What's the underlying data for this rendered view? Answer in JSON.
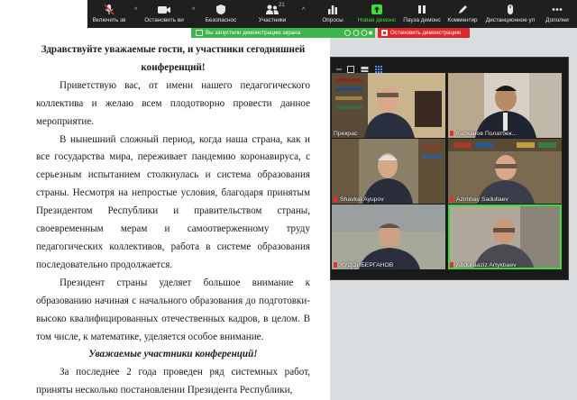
{
  "document": {
    "title": "Здравствуйте уважаемые гости, и участники сегодняшней конференций!",
    "paragraphs": [
      "Приветствую вас, от имени нашего педагогического коллектива и желаю всем плодотворно провести данное мероприятие.",
      "В нынешний сложный период, когда наша страна, как и все государства мира, переживает пандемию коронавируса, с серьезным испытанием столкнулась и система образования страны. Несмотря на непростые условия, благодаря принятым Президентом Республики и правительством страны, своевременным мерам и самоотверженному труду педагогических коллективов, работа в системе образования последовательно продолжается.",
      "Президент страны уделяет большое внимание к образованию начиная с начального образования до подготовки-высоко квалифицированных отечественных кадров, в целом. В том числе, к математике, уделяется особое внимание."
    ],
    "address": "Уважаемые участники конференций!",
    "last_paragraph": "За последнее 2 года проведен ряд системных работ, приняты несколько постановлении Президента Республики,"
  },
  "toolbar": {
    "items": [
      {
        "label": "Включить зв",
        "icon": "mic-muted-icon"
      },
      {
        "label": "Остановить ви",
        "icon": "video-icon"
      },
      {
        "label": "Безопаснос",
        "icon": "shield-icon"
      },
      {
        "label": "Участники",
        "icon": "participants-icon",
        "count": "21"
      },
      {
        "label": "Опросы",
        "icon": "polls-icon"
      },
      {
        "label": "Новая демонс",
        "icon": "share-screen-icon"
      },
      {
        "label": "Пауза демонс",
        "icon": "pause-icon"
      },
      {
        "label": "Комментир",
        "icon": "annotate-icon"
      },
      {
        "label": "Дистанционное уп",
        "icon": "remote-control-icon"
      },
      {
        "label": "Дополни",
        "icon": "more-icon"
      }
    ]
  },
  "share_bar": {
    "text": "Вы запустили демонстрацию экрана",
    "stop_label": "Остановить демонстрацию"
  },
  "participants": [
    {
      "name": "Прекрас",
      "muted": false,
      "active": false
    },
    {
      "name": "Калханов Полатбек...",
      "muted": true,
      "active": false
    },
    {
      "name": "Shavkat Ayupov",
      "muted": true,
      "active": false
    },
    {
      "name": "Azimbay Sadullaev",
      "muted": true,
      "active": false
    },
    {
      "name": "ХУДОЙБЕРГАНОВ",
      "muted": true,
      "active": false
    },
    {
      "name": "Abdullaaziz Artykbaev",
      "muted": true,
      "active": true
    }
  ],
  "colors": {
    "toolbar_bg": "#1f1f1f",
    "share_green": "#3cb54a",
    "stop_red": "#e02828",
    "active_speaker": "#3ddc3d"
  }
}
